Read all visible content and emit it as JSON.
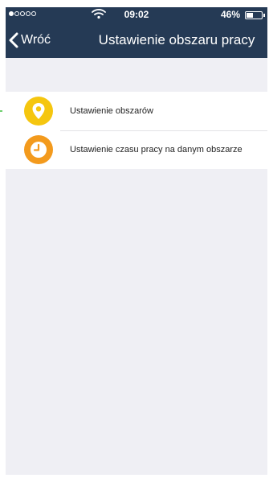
{
  "status_bar": {
    "time": "09:02",
    "battery_percent": "46%",
    "battery_level": 0.46,
    "signal_bars_filled": 1,
    "signal_bars_total": 5,
    "wifi_icon": "wifi-icon"
  },
  "nav": {
    "back_label": "Wróć",
    "back_icon": "chevron-left-icon",
    "title": "Ustawienie obszaru pracy"
  },
  "menu": {
    "items": [
      {
        "label": "Ustawienie obszarów",
        "icon": "location-pin-icon",
        "color": "#f5c60f"
      },
      {
        "label": "Ustawienie czasu pracy na danym obszarze",
        "icon": "clock-icon",
        "color": "#f39a1d"
      }
    ]
  },
  "colors": {
    "header_bg": "#253a55",
    "page_bg": "#efeff4"
  }
}
